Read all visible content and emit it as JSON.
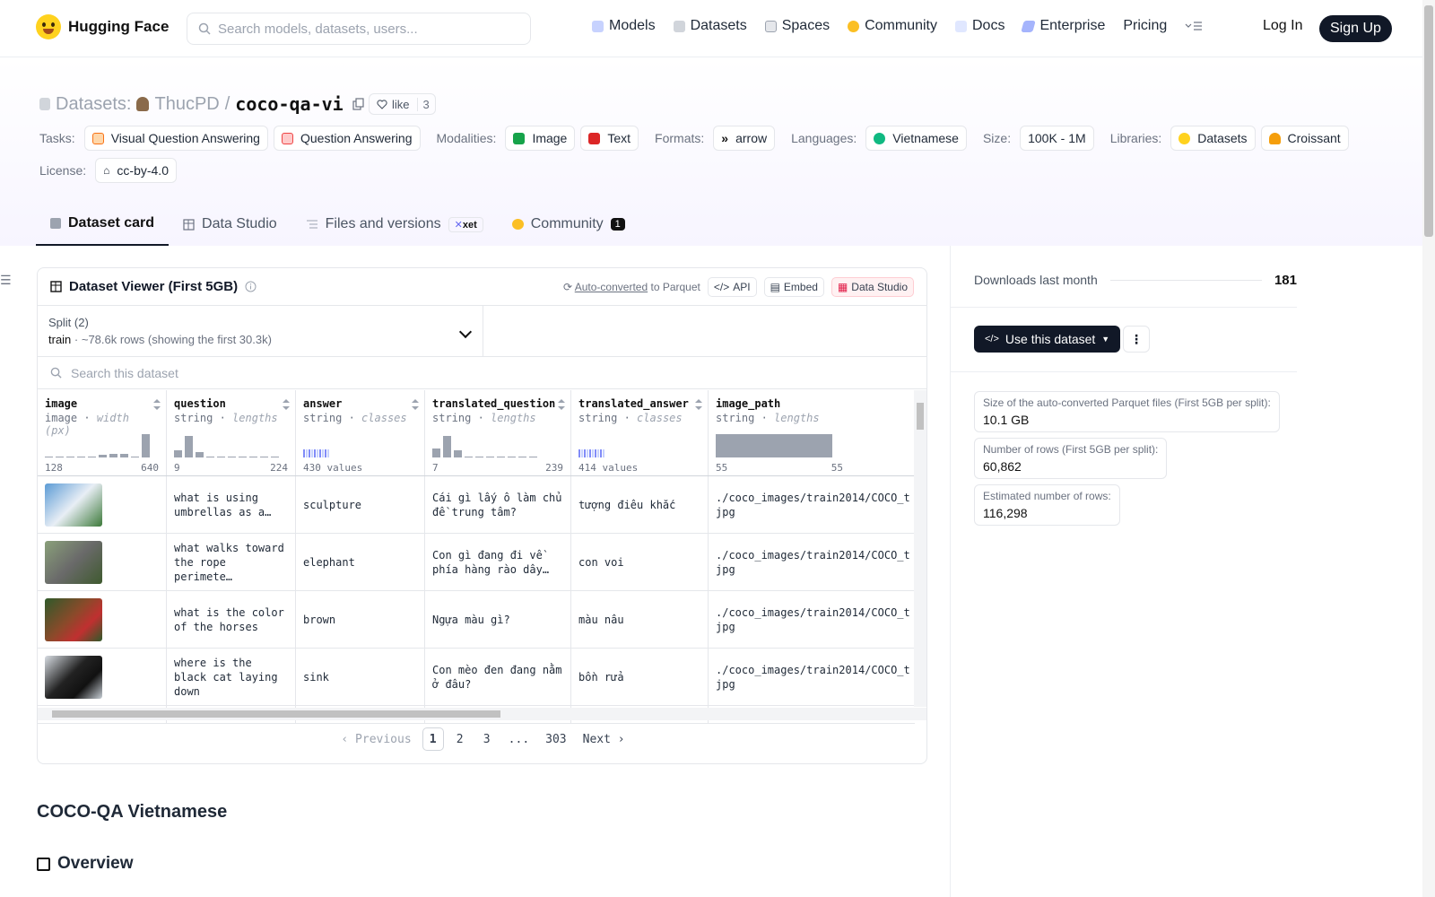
{
  "nav": {
    "logo_text": "Hugging Face",
    "search_placeholder": "Search models, datasets, users...",
    "links": [
      "Models",
      "Datasets",
      "Spaces",
      "Community",
      "Docs",
      "Enterprise",
      "Pricing"
    ],
    "login": "Log In",
    "signup": "Sign Up"
  },
  "header": {
    "section": "Datasets:",
    "owner": "ThucPD",
    "slash": "/",
    "repo": "coco-qa-vi",
    "like_label": "like",
    "like_count": "3",
    "tasks_label": "Tasks:",
    "tasks": [
      "Visual Question Answering",
      "Question Answering"
    ],
    "modalities_label": "Modalities:",
    "modalities": [
      "Image",
      "Text"
    ],
    "formats_label": "Formats:",
    "formats": [
      "arrow"
    ],
    "languages_label": "Languages:",
    "languages": [
      "Vietnamese"
    ],
    "size_label": "Size:",
    "size": "100K - 1M",
    "libraries_label": "Libraries:",
    "libraries": [
      "Datasets",
      "Croissant"
    ],
    "license_label": "License:",
    "license": "cc-by-4.0"
  },
  "tabs": [
    {
      "label": "Dataset card",
      "active": true
    },
    {
      "label": "Data Studio"
    },
    {
      "label": "Files and versions",
      "badge": "xet"
    },
    {
      "label": "Community",
      "badge": "1"
    }
  ],
  "viewer": {
    "title": "Dataset Viewer (First 5GB)",
    "autoconv_link": "Auto-converted",
    "autoconv_rest": "to Parquet",
    "btn_api": "API",
    "btn_embed": "Embed",
    "btn_studio": "Data Studio",
    "split_label": "Split (2)",
    "split_name": "train",
    "split_rows": "~78.6k rows (showing the first 30.3k)",
    "search_placeholder": "Search this dataset",
    "columns": [
      {
        "name": "image",
        "type": "image",
        "stat": "width (px)",
        "min": "128",
        "max": "640"
      },
      {
        "name": "question",
        "type": "string",
        "stat": "lengths",
        "min": "9",
        "max": "224"
      },
      {
        "name": "answer",
        "type": "string",
        "stat": "classes",
        "min": "430 values",
        "max": ""
      },
      {
        "name": "translated_question",
        "type": "string",
        "stat": "lengths",
        "min": "7",
        "max": "239"
      },
      {
        "name": "translated_answer",
        "type": "string",
        "stat": "classes",
        "min": "414 values",
        "max": ""
      },
      {
        "name": "image_path",
        "type": "string",
        "stat": "lengths",
        "min": "55",
        "max": "55"
      }
    ],
    "rows": [
      {
        "question": "what is using umbrellas as a…",
        "answer": "sculpture",
        "tq": "Cái gì lấy ô làm chủ đề trung tâm?",
        "ta": "tượng điêu khắc",
        "path": "./coco_images/train2014/COCO_t jpg",
        "thumb": "#4a7fbf"
      },
      {
        "question": "what walks toward the rope perimete…",
        "answer": "elephant",
        "tq": "Con gì đang đi về phía hàng rào dây…",
        "ta": "con voi",
        "path": "./coco_images/train2014/COCO_t jpg",
        "thumb": "#6c7a5a"
      },
      {
        "question": "what is the color of the horses",
        "answer": "brown",
        "tq": "Ngựa màu gì?",
        "ta": "màu nâu",
        "path": "./coco_images/train2014/COCO_t jpg",
        "thumb": "#8a4a2a"
      },
      {
        "question": "where is the black cat laying down",
        "answer": "sink",
        "tq": "Con mèo đen đang nằm ở đâu?",
        "ta": "bồn rửa",
        "path": "./coco_images/train2014/COCO_t jpg",
        "thumb": "#2a2a2a"
      }
    ],
    "pager": {
      "prev": "Previous",
      "pages": [
        "1",
        "2",
        "3",
        "...",
        "303"
      ],
      "next": "Next"
    }
  },
  "card": {
    "title": "COCO-QA Vietnamese",
    "overview": "Overview"
  },
  "sidebar": {
    "downloads_label": "Downloads last month",
    "downloads": "181",
    "use_btn": "Use this dataset",
    "stats": [
      {
        "k": "Size of the auto-converted Parquet files (First 5GB per split):",
        "v": "10.1 GB"
      },
      {
        "k": "Number of rows (First 5GB per split):",
        "v": "60,862"
      },
      {
        "k": "Estimated number of rows:",
        "v": "116,298"
      }
    ]
  },
  "colors": {
    "accent": "#111827",
    "brand": "#ffd21e",
    "badge_red": "#fff1f2"
  }
}
